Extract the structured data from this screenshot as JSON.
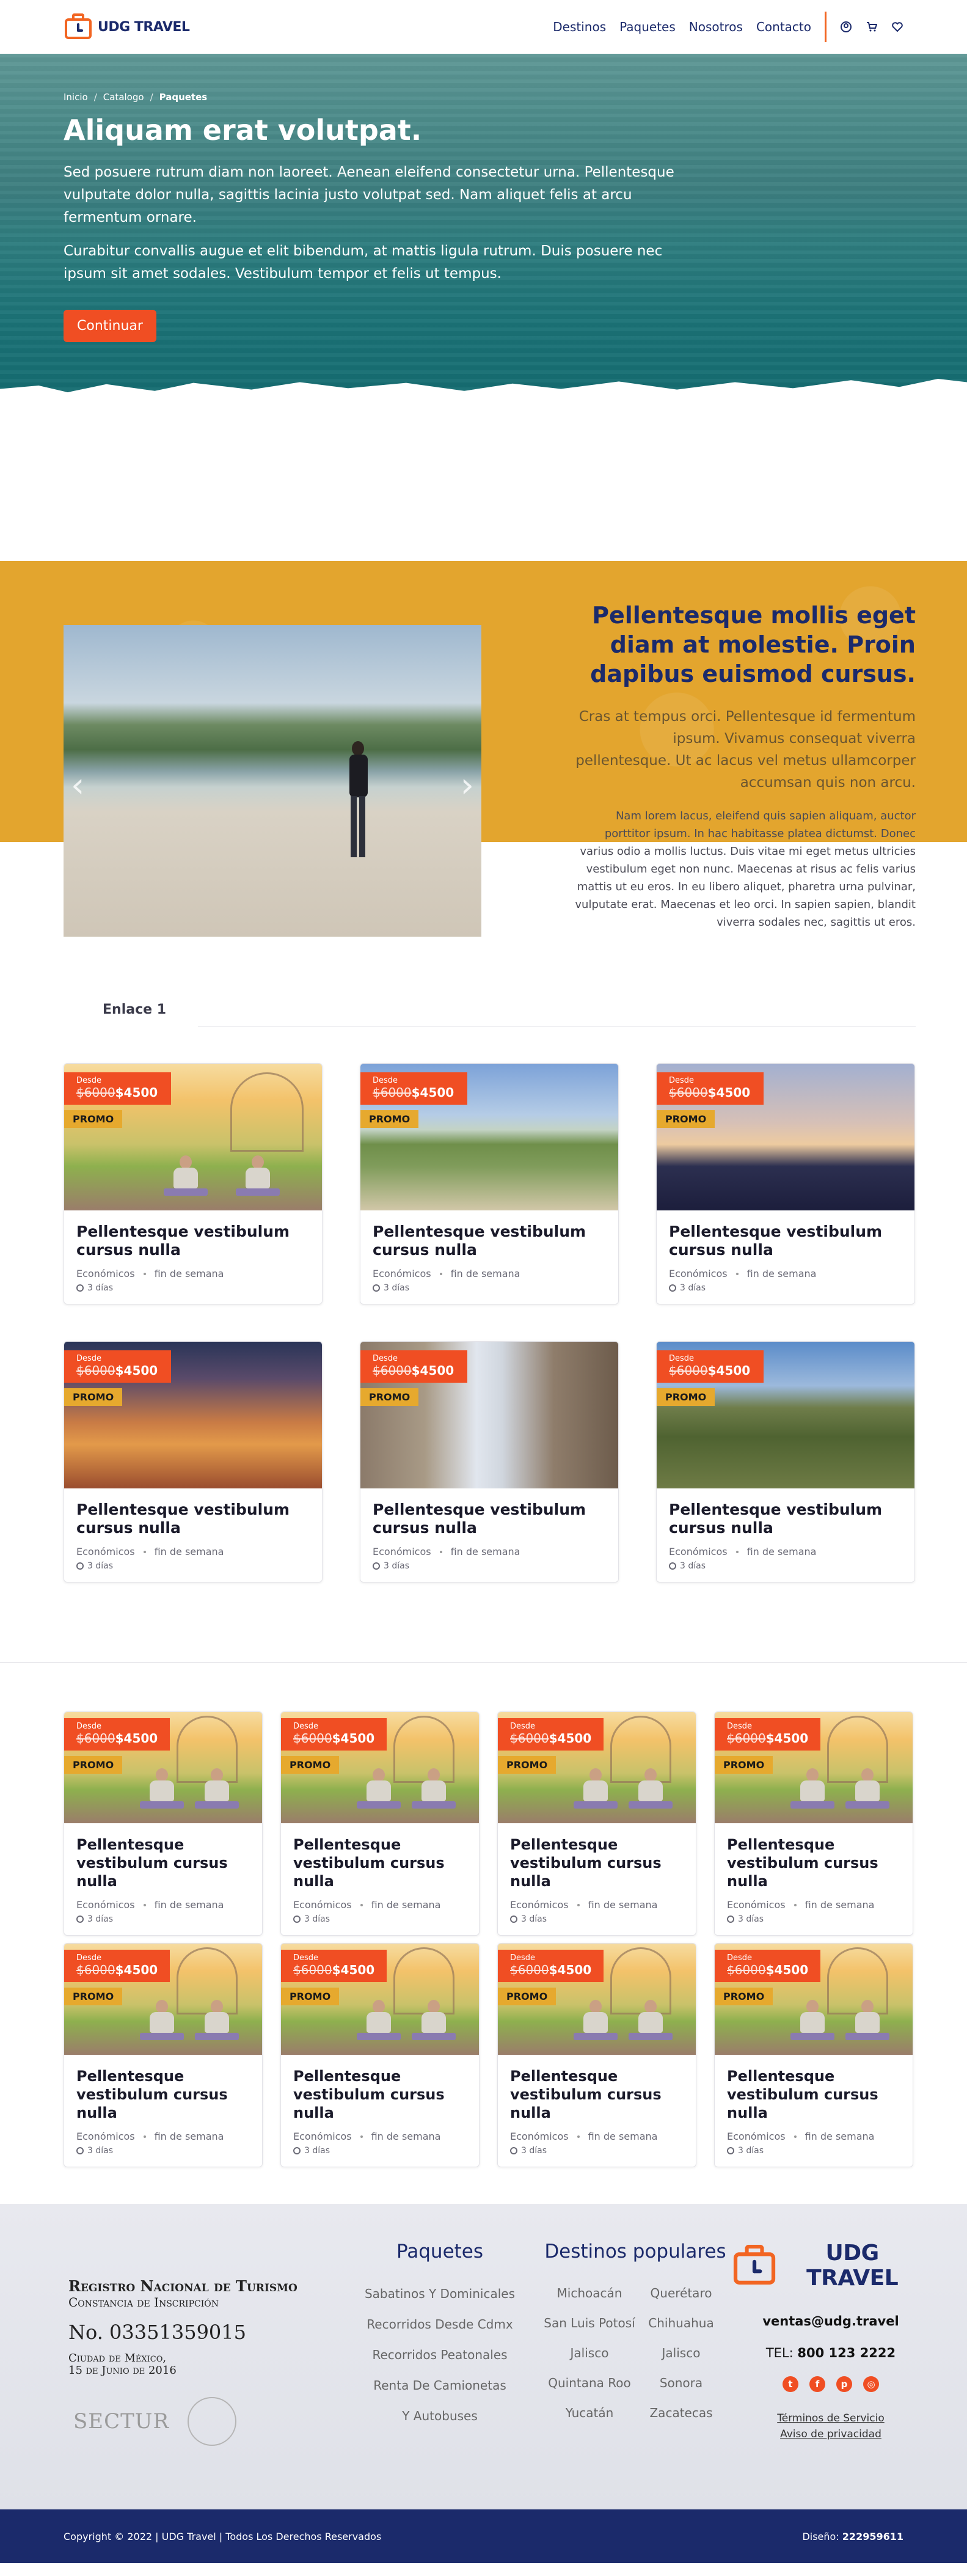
{
  "nav": {
    "logo_text": "UDG TRAVEL",
    "links": [
      "Destinos",
      "Paquetes",
      "Nosotros",
      "Contacto"
    ],
    "icons": [
      "user-icon",
      "cart-icon",
      "heart-icon"
    ]
  },
  "hero": {
    "breadcrumb": [
      "Inicio",
      "Catalogo",
      "Paquetes"
    ],
    "title": "Aliquam erat volutpat.",
    "paragraph1": "Sed posuere rutrum diam non laoreet. Aenean eleifend consectetur urna. Pellentesque vulputate dolor nulla, sagittis lacinia justo volutpat sed. Nam aliquet felis at arcu fermentum ornare.",
    "paragraph2": "Curabitur convallis augue et elit bibendum, at mattis ligula rutrum. Duis posuere nec ipsum sit amet sodales. Vestibulum tempor et felis ut tempus.",
    "button": "Continuar"
  },
  "feature": {
    "title": "Pellentesque mollis eget diam at molestie. Proin dapibus euismod cursus.",
    "lead": "Cras at tempus orci. Pellentesque id fermentum ipsum. Vivamus consequat viverra pellentesque. Ut ac lacus vel metus ullamcorper accumsan quis non arcu.",
    "body": "Nam lorem lacus, eleifend quis sapien aliquam, auctor porttitor ipsum. In hac habitasse platea dictumst. Donec varius odio a mollis luctus. Duis vitae mi eget metus ultricies vestibulum eget non nunc. Maecenas at risus ac felis varius mattis ut eu eros. In eu libero aliquet, pharetra urna pulvinar, vulputate erat. Maecenas et leo orci. In sapien sapien, blandit viverra sodales nec, sagittis ut eros.",
    "prev": "‹",
    "next": "›"
  },
  "tabs": {
    "active": "Enlace 1"
  },
  "card_common": {
    "desde": "Desde",
    "old_price": "$6000",
    "new_price": "$4500",
    "promo": "PROMO",
    "title": "Pellentesque vestibulum cursus nulla",
    "type": "Económicos",
    "period": "fin de semana",
    "duration": "3 días"
  },
  "grid3": {
    "cards": [
      {
        "image": "yoga"
      },
      {
        "image": "path"
      },
      {
        "image": "mtn"
      },
      {
        "image": "city"
      },
      {
        "image": "street"
      },
      {
        "image": "forest"
      }
    ]
  },
  "footer": {
    "registro_title": "Registro Nacional de Turismo",
    "registro_sub": "Constancia de Inscripción",
    "registro_no": "No. 03351359015",
    "registro_city": "Ciudad de México,",
    "registro_date": "15 de Junio de 2016",
    "sectur": "SECTUR",
    "paquetes_title": "Paquetes",
    "paquetes": [
      "Sabatinos Y Dominicales",
      "Recorridos Desde Cdmx",
      "Recorridos Peatonales",
      "Renta De Camionetas",
      "Y Autobuses"
    ],
    "destinos_title": "Destinos populares",
    "destinos": [
      "Michoacán",
      "Querétaro",
      "San Luis Potosí",
      "Chihuahua",
      "Jalisco",
      "Jalisco",
      "Quintana Roo",
      "Sonora",
      "Yucatán",
      "Zacatecas"
    ],
    "logo_text": "UDG TRAVEL",
    "email": "ventas@udg.travel",
    "tel_label": "TEL:",
    "tel": "800 123 2222",
    "socials": [
      "twitter-icon",
      "facebook-icon",
      "pinterest-icon",
      "instagram-icon"
    ],
    "terms": "Términos de Servicio",
    "privacy": "Aviso de privacidad"
  },
  "bottom": {
    "copyright": "Copyright © 2022   |   UDG Travel   |   Todos Los Derechos Reservados",
    "design_label": "Diseño:",
    "design_value": "222959611"
  },
  "colors": {
    "primary": "#f04e23",
    "navy": "#1b2a6b",
    "gold": "#e3a52e"
  }
}
